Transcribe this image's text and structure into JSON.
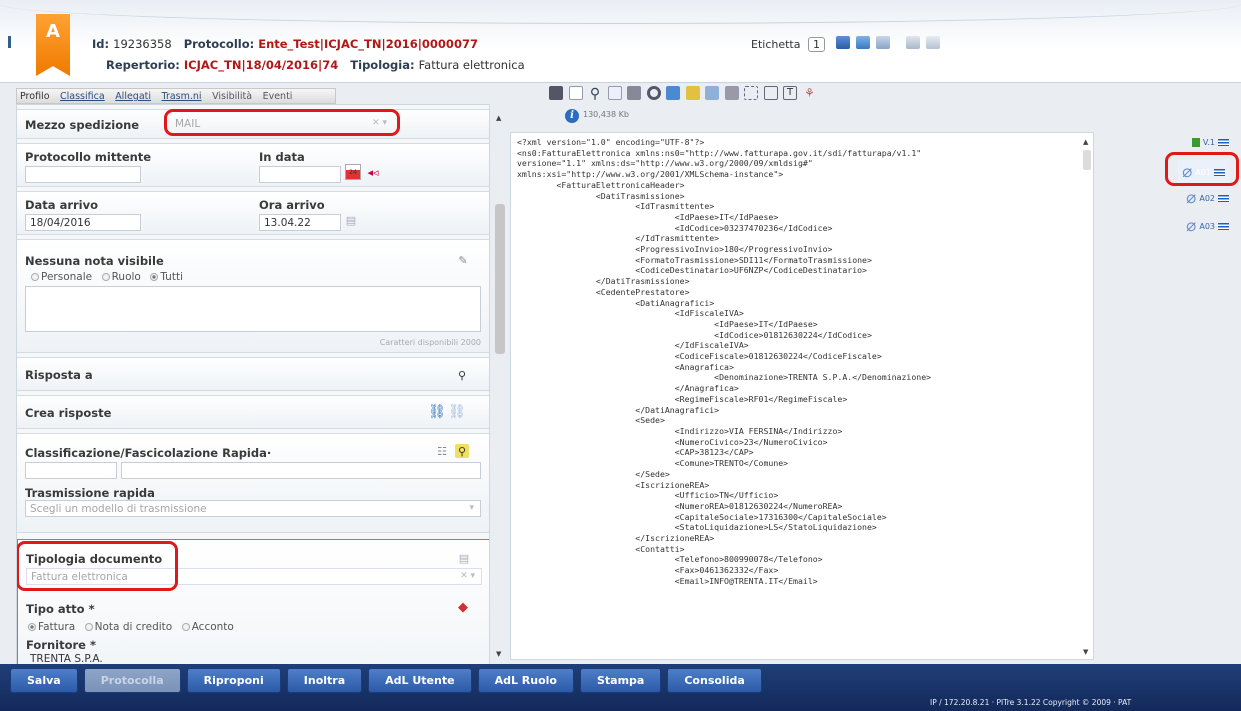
{
  "header": {
    "badge": "A",
    "id_label": "Id:",
    "id_value": "19236358",
    "protocollo_label": "Protocollo:",
    "protocollo_value": "Ente_Test|ICJAC_TN|2016|0000077",
    "repertorio_label": "Repertorio:",
    "repertorio_value": "ICJAC_TN|18/04/2016|74",
    "tipologia_label": "Tipologia:",
    "tipologia_value": "Fattura elettronica",
    "etichetta_label": "Etichetta",
    "etichetta_count": "1"
  },
  "tabs": [
    "Profilo",
    "Classifica",
    "Allegati",
    "Trasm.ni",
    "Visibilità",
    "Eventi"
  ],
  "profile": {
    "mezzo_spedizione_label": "Mezzo spedizione",
    "mezzo_spedizione_value": "MAIL",
    "protocollo_mittente_label": "Protocollo mittente",
    "in_data_label": "In data",
    "data_arrivo_label": "Data arrivo",
    "data_arrivo_value": "18/04/2016",
    "ora_arrivo_label": "Ora arrivo",
    "ora_arrivo_value": "13.04.22",
    "nota_label": "Nessuna nota visibile",
    "radio_options": [
      "Personale",
      "Ruolo",
      "Tutti"
    ],
    "radio_selected": "Tutti",
    "caratteri": "Caratteri disponibili 2000",
    "risposta_label": "Risposta a",
    "crea_risposte_label": "Crea risposte",
    "classificazione_label": "Classificazione/Fascicolazione Rapida·",
    "trasmissione_label": "Trasmissione rapida",
    "trasmissione_placeholder": "Scegli un modello di trasmissione",
    "tipologia_doc_label": "Tipologia documento",
    "tipologia_doc_value": "Fattura elettronica",
    "tipo_atto_label": "Tipo atto *",
    "tipo_atto_options": [
      "Fattura",
      "Nota di credito",
      "Acconto"
    ],
    "tipo_atto_selected": "Fattura",
    "fornitore_label": "Fornitore *",
    "fornitore_value": "TRENTA S.P.A."
  },
  "viewer": {
    "file_size": "130,438 Kb",
    "xml_lines": [
      "<?xml version=\"1.0\" encoding=\"UTF-8\"?>",
      "<ns0:FatturaElettronica xmlns:ns0=\"http://www.fatturapa.gov.it/sdi/fatturapa/v1.1\"",
      "versione=\"1.1\" xmlns:ds=\"http://www.w3.org/2000/09/xmldsig#\"",
      "xmlns:xsi=\"http://www.w3.org/2001/XMLSchema-instance\">",
      "        <FatturaElettronicaHeader>",
      "                <DatiTrasmissione>",
      "                        <IdTrasmittente>",
      "                                <IdPaese>IT</IdPaese>",
      "                                <IdCodice>03237470236</IdCodice>",
      "                        </IdTrasmittente>",
      "                        <ProgressivoInvio>180</ProgressivoInvio>",
      "                        <FormatoTrasmissione>SDI11</FormatoTrasmissione>",
      "                        <CodiceDestinatario>UF6NZP</CodiceDestinatario>",
      "                </DatiTrasmissione>",
      "                <CedentePrestatore>",
      "                        <DatiAnagrafici>",
      "                                <IdFiscaleIVA>",
      "                                        <IdPaese>IT</IdPaese>",
      "                                        <IdCodice>01812630224</IdCodice>",
      "                                </IdFiscaleIVA>",
      "                                <CodiceFiscale>01812630224</CodiceFiscale>",
      "                                <Anagrafica>",
      "                                        <Denominazione>TRENTA S.P.A.</Denominazione>",
      "                                </Anagrafica>",
      "                                <RegimeFiscale>RF01</RegimeFiscale>",
      "                        </DatiAnagrafici>",
      "                        <Sede>",
      "                                <Indirizzo>VIA FERSINA</Indirizzo>",
      "                                <NumeroCivico>23</NumeroCivico>",
      "                                <CAP>38123</CAP>",
      "                                <Comune>TRENTO</Comune>",
      "                        </Sede>",
      "                        <IscrizioneREA>",
      "                                <Ufficio>TN</Ufficio>",
      "                                <NumeroREA>01812630224</NumeroREA>",
      "                                <CapitaleSociale>17316300</CapitaleSociale>",
      "                                <StatoLiquidazione>LS</StatoLiquidazione>",
      "                        </IscrizioneREA>",
      "                        <Contatti>",
      "                                <Telefono>800990078</Telefono>",
      "                                <Fax>0461362332</Fax>",
      "                                <Email>INFO@TRENTA.IT</Email>"
    ]
  },
  "versions": [
    "V.1",
    "A01",
    "A02",
    "A03"
  ],
  "footer": {
    "buttons": [
      "Salva",
      "Protocolla",
      "Riproponi",
      "Inoltra",
      "AdL Utente",
      "AdL Ruolo",
      "Stampa",
      "Consolida"
    ],
    "disabled": [
      "Protocolla"
    ],
    "copyright": "IP / 172.20.8.21 · PITre 3.1.22 Copyright © 2009 · PAT"
  },
  "colors": {
    "accent_orange": "#f07a00",
    "header_red": "#b01818",
    "footer_blue": "#1f3f78",
    "annotation_red": "#e01818"
  }
}
